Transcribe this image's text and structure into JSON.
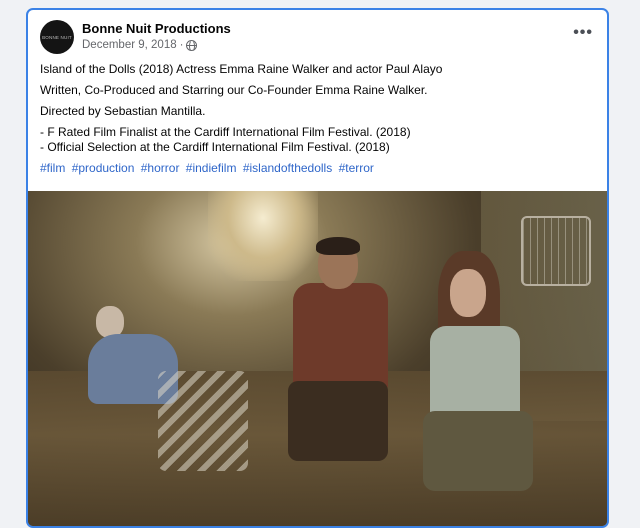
{
  "post": {
    "page_name": "Bonne Nuit Productions",
    "avatar_text": "BONNE NUIT",
    "date": "December 9, 2018",
    "separator": "·",
    "privacy_icon": "globe-icon",
    "more_icon": "more-options-icon",
    "more_label": "•••"
  },
  "text": {
    "line1": "Island of the Dolls (2018) Actress Emma Raine Walker and actor Paul Alayo",
    "line2": "Written, Co-Produced and Starring our Co-Founder Emma Raine Walker.",
    "line3": "Directed by Sebastian Mantilla.",
    "line4": "- F Rated Film Finalist at the Cardiff International Film Festival. (2018)",
    "line5": "- Official Selection at the Cardiff International Film Festival. (2018)"
  },
  "hashtags": [
    "#film",
    "#production",
    "#horror",
    "#indiefilm",
    "#islandofthedolls",
    "#terror"
  ],
  "colors": {
    "card_border": "#3b82e6",
    "hashtag": "#2f66c9",
    "meta_gray": "#65676b"
  }
}
